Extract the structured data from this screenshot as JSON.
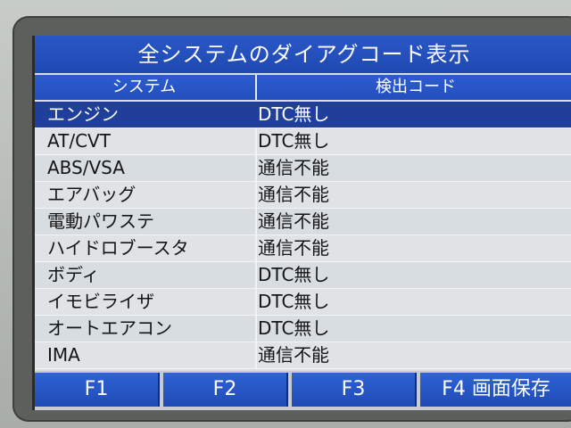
{
  "screen": {
    "title": "全システムのダイアグコード表示",
    "headers": {
      "system": "システム",
      "code": "検出コード"
    },
    "rows": [
      {
        "system": "エンジン",
        "code": "DTC無し",
        "selected": true
      },
      {
        "system": "AT/CVT",
        "code": "DTC無し",
        "selected": false
      },
      {
        "system": "ABS/VSA",
        "code": "通信不能",
        "selected": false
      },
      {
        "system": "エアバッグ",
        "code": "通信不能",
        "selected": false
      },
      {
        "system": "電動パワステ",
        "code": "通信不能",
        "selected": false
      },
      {
        "system": "ハイドロブースタ",
        "code": "通信不能",
        "selected": false
      },
      {
        "system": "ボディ",
        "code": "DTC無し",
        "selected": false
      },
      {
        "system": "イモビライザ",
        "code": "DTC無し",
        "selected": false
      },
      {
        "system": "オートエアコン",
        "code": "DTC無し",
        "selected": false
      },
      {
        "system": "IMA",
        "code": "通信不能",
        "selected": false
      }
    ],
    "function_keys": {
      "f1": "F1",
      "f2": "F2",
      "f3": "F3",
      "f4": "F4 画面保存"
    }
  },
  "colors": {
    "title_bar": "#1f49b3",
    "header_bar": "#224fbd",
    "selected_row": "#1f3f9b",
    "row_bg": "#dfe3e6",
    "fn_button": "#1f4bb4"
  }
}
